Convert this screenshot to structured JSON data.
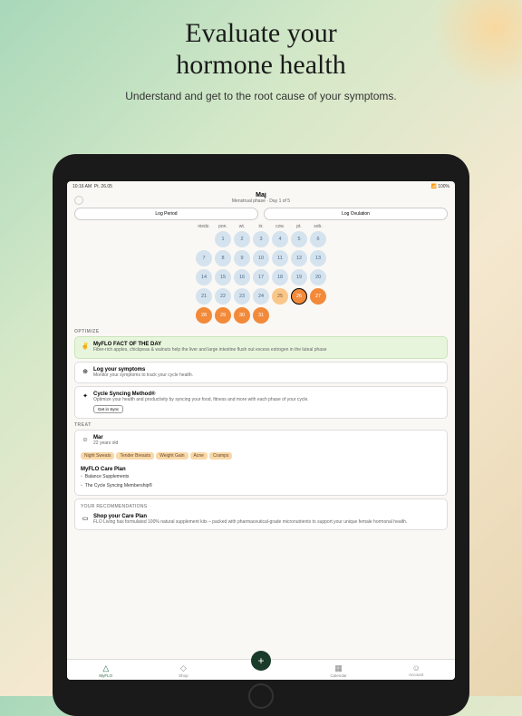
{
  "hero": {
    "title_l1": "Evaluate your",
    "title_l2": "hormone health",
    "subtitle": "Understand and get to the root cause of your symptoms."
  },
  "status": {
    "time": "10:16 AM",
    "date": "Pt. 26.05",
    "battery": "100%"
  },
  "header": {
    "month": "Maj",
    "phase": "Menstrual phase · Day 1 of 5"
  },
  "buttons": {
    "log_period": "Log Period",
    "log_ovulation": "Log Ovulation"
  },
  "cal": {
    "dow": [
      "niedz.",
      "pon.",
      "wt.",
      "śr.",
      "czw.",
      "pt.",
      "sob."
    ],
    "days": [
      {
        "n": "",
        "c": ""
      },
      {
        "n": 1,
        "c": "d-blue"
      },
      {
        "n": 2,
        "c": "d-blue"
      },
      {
        "n": 3,
        "c": "d-blue"
      },
      {
        "n": 4,
        "c": "d-blue"
      },
      {
        "n": 5,
        "c": "d-blue"
      },
      {
        "n": 6,
        "c": "d-blue"
      },
      {
        "n": 7,
        "c": "d-blue"
      },
      {
        "n": 8,
        "c": "d-blue"
      },
      {
        "n": 9,
        "c": "d-blue"
      },
      {
        "n": 10,
        "c": "d-blue"
      },
      {
        "n": 11,
        "c": "d-blue"
      },
      {
        "n": 12,
        "c": "d-blue"
      },
      {
        "n": 13,
        "c": "d-blue"
      },
      {
        "n": 14,
        "c": "d-blue"
      },
      {
        "n": 15,
        "c": "d-blue"
      },
      {
        "n": 16,
        "c": "d-blue"
      },
      {
        "n": 17,
        "c": "d-blue"
      },
      {
        "n": 18,
        "c": "d-blue"
      },
      {
        "n": 19,
        "c": "d-blue"
      },
      {
        "n": 20,
        "c": "d-blue"
      },
      {
        "n": 21,
        "c": "d-blue"
      },
      {
        "n": 22,
        "c": "d-blue"
      },
      {
        "n": 23,
        "c": "d-blue"
      },
      {
        "n": 24,
        "c": "d-blue"
      },
      {
        "n": 25,
        "c": "d-oo"
      },
      {
        "n": 26,
        "c": "d-cur"
      },
      {
        "n": 27,
        "c": "d-or"
      },
      {
        "n": 28,
        "c": "d-or"
      },
      {
        "n": 29,
        "c": "d-or"
      },
      {
        "n": 30,
        "c": "d-or"
      },
      {
        "n": 31,
        "c": "d-or"
      },
      {
        "n": "",
        "c": ""
      },
      {
        "n": "",
        "c": ""
      },
      {
        "n": "",
        "c": ""
      }
    ]
  },
  "sections": {
    "optimize": "OPTIMIZE",
    "treat": "TREAT"
  },
  "fact": {
    "title": "MyFLO FACT OF THE DAY",
    "body": "Fiber-rich apples, chickpeas & walnuts help the liver and large intestine flush out excess estrogen in the luteal phase"
  },
  "symptoms": {
    "title": "Log your symptoms",
    "body": "Monitor your symptoms to track your cycle health."
  },
  "sync": {
    "title": "Cycle Syncing Method®",
    "body": "Optimize your health and productivity by syncing your food, fitness and more with each phase of your cycle.",
    "btn": "Get in Sync"
  },
  "profile": {
    "name": "Mar",
    "age": "22 years old",
    "tags": [
      "Night Sweats",
      "Tender Breasts",
      "Weight Gain",
      "Acne",
      "Cramps"
    ]
  },
  "careplan": {
    "title": "MyFLO Care Plan",
    "items": [
      "Balance Supplements",
      "The Cycle Syncing Membership®"
    ]
  },
  "recs": {
    "label": "YOUR RECOMMENDATIONS",
    "title": "Shop your Care Plan",
    "body": "FLO Living has formulated 100% natural supplement kits – packed with pharmaceutical-grade micronutrients to support your unique female hormonal health."
  },
  "tabs": [
    {
      "label": "MyFLO",
      "icon": "△",
      "active": true
    },
    {
      "label": "Shop",
      "icon": "◇",
      "active": false
    },
    {
      "label": "",
      "icon": "",
      "active": false
    },
    {
      "label": "Calendar",
      "icon": "▦",
      "active": false
    },
    {
      "label": "Account",
      "icon": "☺",
      "active": false
    }
  ]
}
